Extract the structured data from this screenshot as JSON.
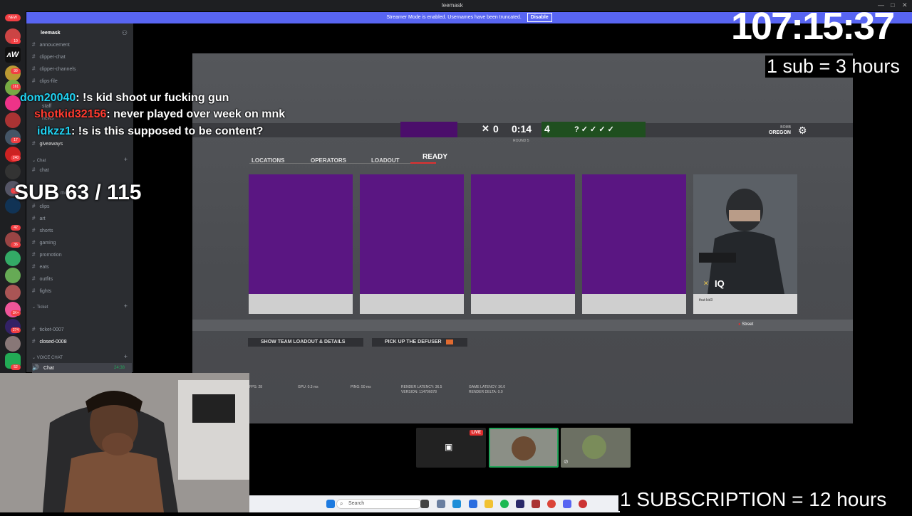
{
  "window": {
    "title": "leemask",
    "controls": [
      "—",
      "□",
      "✕"
    ]
  },
  "streamer_banner": {
    "text": "Streamer Mode is enabled. Usernames have been truncated.",
    "button": "Disable"
  },
  "rail_badges": [
    "NEW",
    "10",
    "99",
    "161",
    "17",
    "240",
    "30",
    "42",
    "36",
    "1K+",
    "274",
    "52"
  ],
  "sidebar": {
    "server_name": "leemask",
    "channels_top": [
      "annoucement",
      "clipper-chat",
      "clipper-channels",
      "clips-file"
    ],
    "channels_mid": [
      "staff",
      "news",
      "giveaways"
    ],
    "category_chat": "Chat",
    "chat_channels": [
      "chat",
      "movies",
      "clips",
      "art",
      "shorts",
      "gaming",
      "promotion",
      "eats",
      "outfits",
      "fights"
    ],
    "category_ticket": "Ticket",
    "ticket_channels": [
      "ticket-0007",
      "closed-0008"
    ],
    "category_voice": "VOICE CHAT",
    "voice_channel": "Chat",
    "voice_time": "24:38"
  },
  "chat_overlay": [
    {
      "user": "dom20040",
      "message": ": !s kid shoot ur fucking gun"
    },
    {
      "user": "shotkid32156",
      "message": ": never played over week on mnk"
    },
    {
      "user": "idkzz1",
      "message": ": !s is this supposed to be content?"
    }
  ],
  "sub_counter": "SUB 63 / 115",
  "subathon": {
    "timer": "107:15:37",
    "sub_rate": "1 sub = 3 hours",
    "subscription_rate": "1 SUBSCRIPTION = 12 hours"
  },
  "game": {
    "score_left": "0",
    "round_time": "0:14",
    "score_right": "4",
    "round_label": "ROUND 5",
    "map_top": "BOMB",
    "map_name": "OREGON",
    "tabs": [
      "LOCATIONS",
      "OPERATORS",
      "LOADOUT",
      "READY"
    ],
    "operator_name": "IQ",
    "operator_player": "that-kid3",
    "location": "Street",
    "buttons": [
      "SHOW TEAM LOADOUT & DETAILS",
      "PICK UP THE DEFUSER"
    ],
    "stats": {
      "fps": "FPS: 28",
      "gpu": "GPU: 0.3 ms",
      "ping": "PING: 50 ms",
      "render_latency": "RENDER LATENCY: 36.5",
      "version": "VERSION: 114706078",
      "game_latency": "GAME LATENCY: 36.0",
      "render_delta": "RENDER DELTA: 0.0"
    }
  },
  "call": {
    "live_label": "LIVE"
  },
  "taskbar": {
    "search_placeholder": "Search"
  }
}
